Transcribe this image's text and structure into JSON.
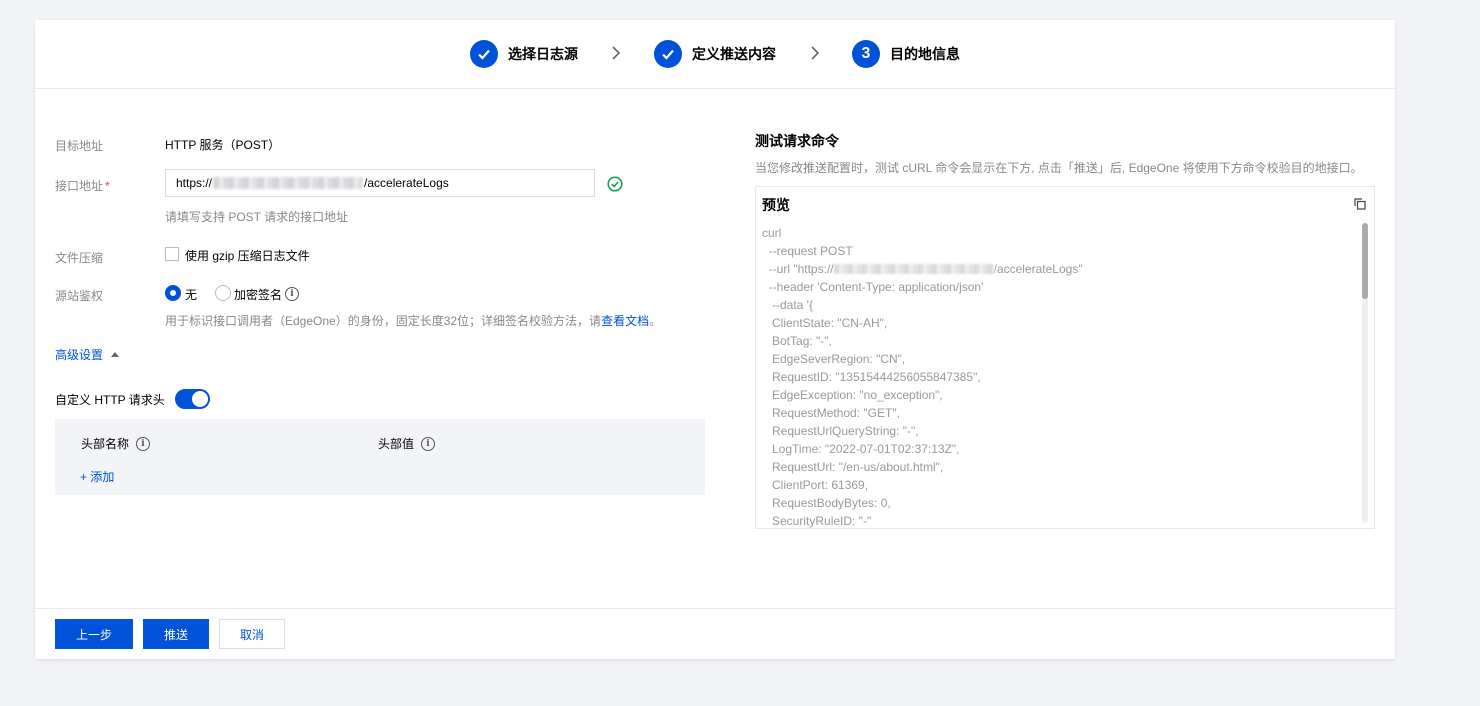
{
  "steps": [
    {
      "label": "选择日志源",
      "state": "done"
    },
    {
      "label": "定义推送内容",
      "state": "done"
    },
    {
      "label": "目的地信息",
      "state": "current",
      "number": "3"
    }
  ],
  "form": {
    "target_label": "目标地址",
    "target_value": "HTTP 服务（POST）",
    "endpoint_label": "接口地址",
    "endpoint_required": "*",
    "endpoint_prefix": "https://",
    "endpoint_suffix": "/accelerateLogs",
    "endpoint_hint": "请填写支持 POST 请求的接口地址",
    "compress_label": "文件压缩",
    "compress_option": "使用 gzip 压缩日志文件",
    "auth_label": "源站鉴权",
    "auth_options": [
      "无",
      "加密签名"
    ],
    "auth_hint": "用于标识接口调用者（EdgeOne）的身份，固定长度32位；详细签名校验方法，请",
    "auth_hint_link": "查看文档",
    "auth_hint_end": "。",
    "advanced_label": "高级设置",
    "custom_header_label": "自定义 HTTP 请求头",
    "header_name_col": "头部名称",
    "header_value_col": "头部值",
    "add_label": "+ 添加"
  },
  "preview": {
    "title": "测试请求命令",
    "description": "当您修改推送配置时，测试 cURL 命令会显示在下方, 点击「推送」后, EdgeOne 将使用下方命令校验目的地接口。",
    "box_title": "预览",
    "lines": [
      "curl",
      "  --request POST",
      "  --url \"https://",
      "  --header 'Content-Type: application/json'",
      "   --data '{",
      "   ClientState: \"CN-AH\",",
      "   BotTag: \"-\",",
      "   EdgeSeverRegion: \"CN\",",
      "   RequestID: \"13515444256055847385\",",
      "   EdgeException: \"no_exception\",",
      "   RequestMethod: \"GET\",",
      "   RequestUrlQueryString: \"-\",",
      "   LogTime: \"2022-07-01T02:37:13Z\",",
      "   RequestUrl: \"/en-us/about.html\",",
      "   ClientPort: 61369,",
      "   RequestBodyBytes: 0,",
      "   SecurityRuleID: \"-\""
    ],
    "url_line_suffix": "/accelerateLogs\""
  },
  "footer": {
    "prev_label": "上一步",
    "push_label": "推送",
    "cancel_label": "取消"
  },
  "colors": {
    "accent": "#0052d9",
    "success": "#07a346",
    "required": "#e54545"
  }
}
